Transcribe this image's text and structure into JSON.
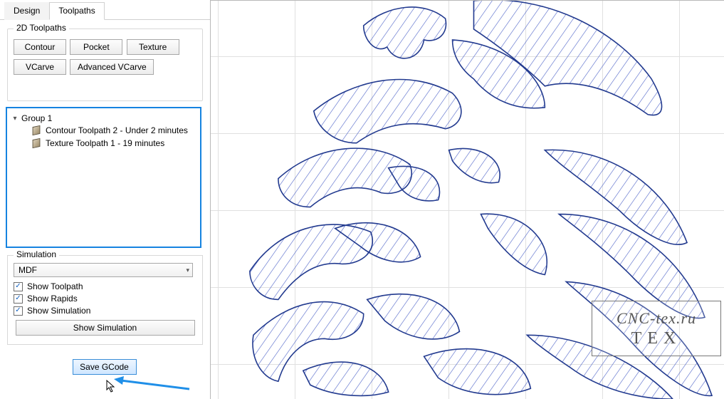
{
  "tabs": {
    "design": "Design",
    "toolpaths": "Toolpaths"
  },
  "sections": {
    "toolpaths2d": {
      "title": "2D Toolpaths",
      "buttons": {
        "contour": "Contour",
        "pocket": "Pocket",
        "texture": "Texture",
        "vcarve": "VCarve",
        "adv_vcarve": "Advanced VCarve"
      }
    },
    "tree": {
      "group": "Group 1",
      "items": [
        "Contour Toolpath 2 - Under 2 minutes",
        "Texture Toolpath 1 - 19 minutes"
      ]
    },
    "simulation": {
      "title": "Simulation",
      "material": "MDF",
      "checks": {
        "show_toolpath": "Show Toolpath",
        "show_rapids": "Show Rapids",
        "show_simulation": "Show Simulation"
      },
      "show_sim_btn": "Show Simulation"
    },
    "save_gcode": "Save GCode"
  },
  "watermark": {
    "line1": "CNC-tex.ru",
    "line2": "TEX"
  },
  "colors": {
    "highlight_border": "#1683e0",
    "toolpath_stroke": "#223a8f",
    "hatch_stroke": "#4d63c8",
    "arrow": "#1f8fe8"
  }
}
